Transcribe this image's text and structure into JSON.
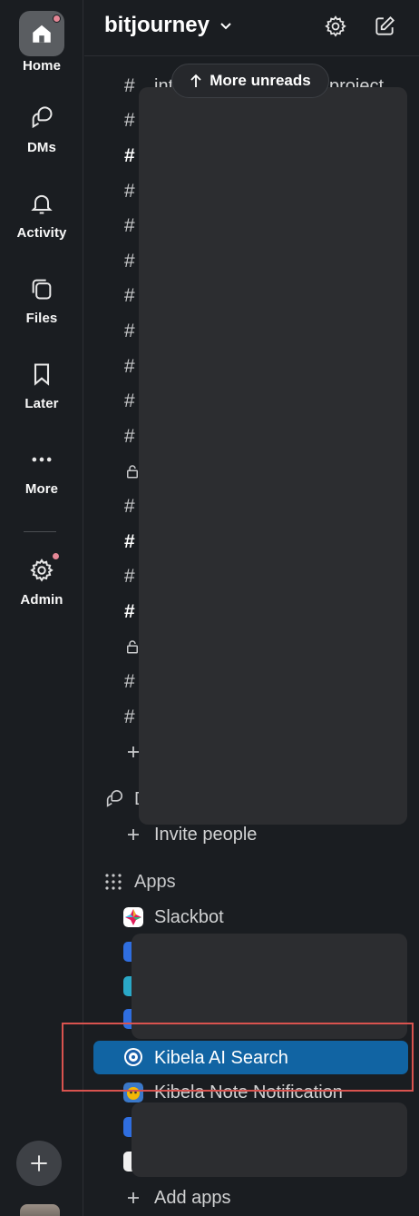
{
  "rail": {
    "items": [
      {
        "label": "Home",
        "icon": "home-icon"
      },
      {
        "label": "DMs",
        "icon": "dms-icon"
      },
      {
        "label": "Activity",
        "icon": "bell-icon"
      },
      {
        "label": "Files",
        "icon": "files-icon"
      },
      {
        "label": "Later",
        "icon": "bookmark-icon"
      },
      {
        "label": "More",
        "icon": "more-icon"
      },
      {
        "label": "Admin",
        "icon": "gear-icon"
      }
    ],
    "notification_color": "#e58796"
  },
  "header": {
    "workspace_name": "bitjourney"
  },
  "sidebar": {
    "unreads_pill": "More unreads",
    "partial_top_text": "info",
    "partial_channel_text": "int",
    "partial_channel_text_right": "project",
    "dm_section_partial": "D",
    "invite_people": "Invite people",
    "apps_label": "Apps",
    "apps": [
      {
        "name": "Slackbot"
      },
      {
        "name": "Kibela AI Search",
        "selected": true
      },
      {
        "name": "Kibela Note Notification"
      }
    ],
    "add_apps": "Add apps",
    "selected_color": "#1164a3"
  }
}
